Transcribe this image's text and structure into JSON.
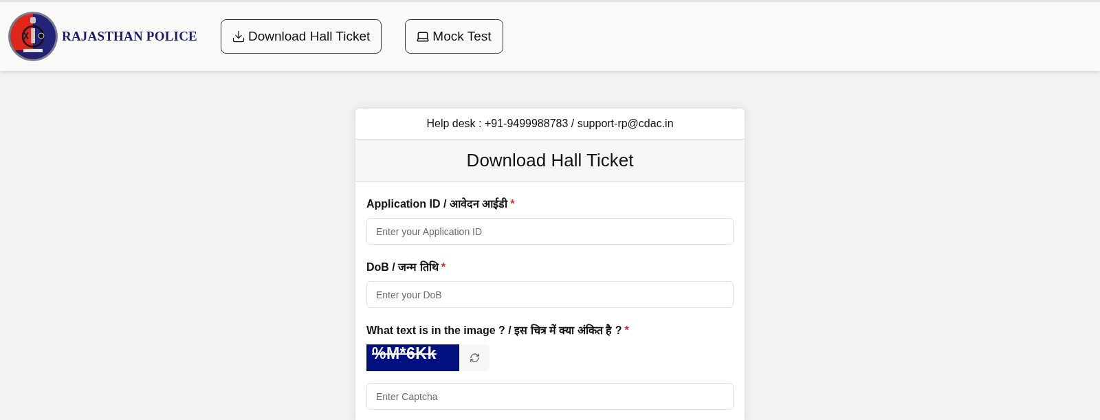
{
  "header": {
    "logo_text": "RAJASTHAN POLICE",
    "nav_buttons": [
      {
        "label": "Download Hall Ticket",
        "kind": "download"
      },
      {
        "label": "Mock Test",
        "kind": "laptop"
      }
    ]
  },
  "card": {
    "help_desk": "Help desk : +91-9499988783 / support-rp@cdac.in",
    "title": "Download Hall Ticket",
    "fields": [
      {
        "kind": "text",
        "label": "Application ID / आवेदन आईडी",
        "required_mark": "*",
        "placeholder": "Enter your Application ID"
      },
      {
        "kind": "text",
        "label": "DoB / जन्म तिथि",
        "required_mark": "*",
        "placeholder": "Enter your DoB"
      },
      {
        "kind": "captcha",
        "label": "What text is in the image ? / इस चित्र में क्या अंकित है ?",
        "required_mark": "*",
        "captcha_text": "%M*6Kk",
        "placeholder": "Enter Captcha"
      }
    ]
  }
}
